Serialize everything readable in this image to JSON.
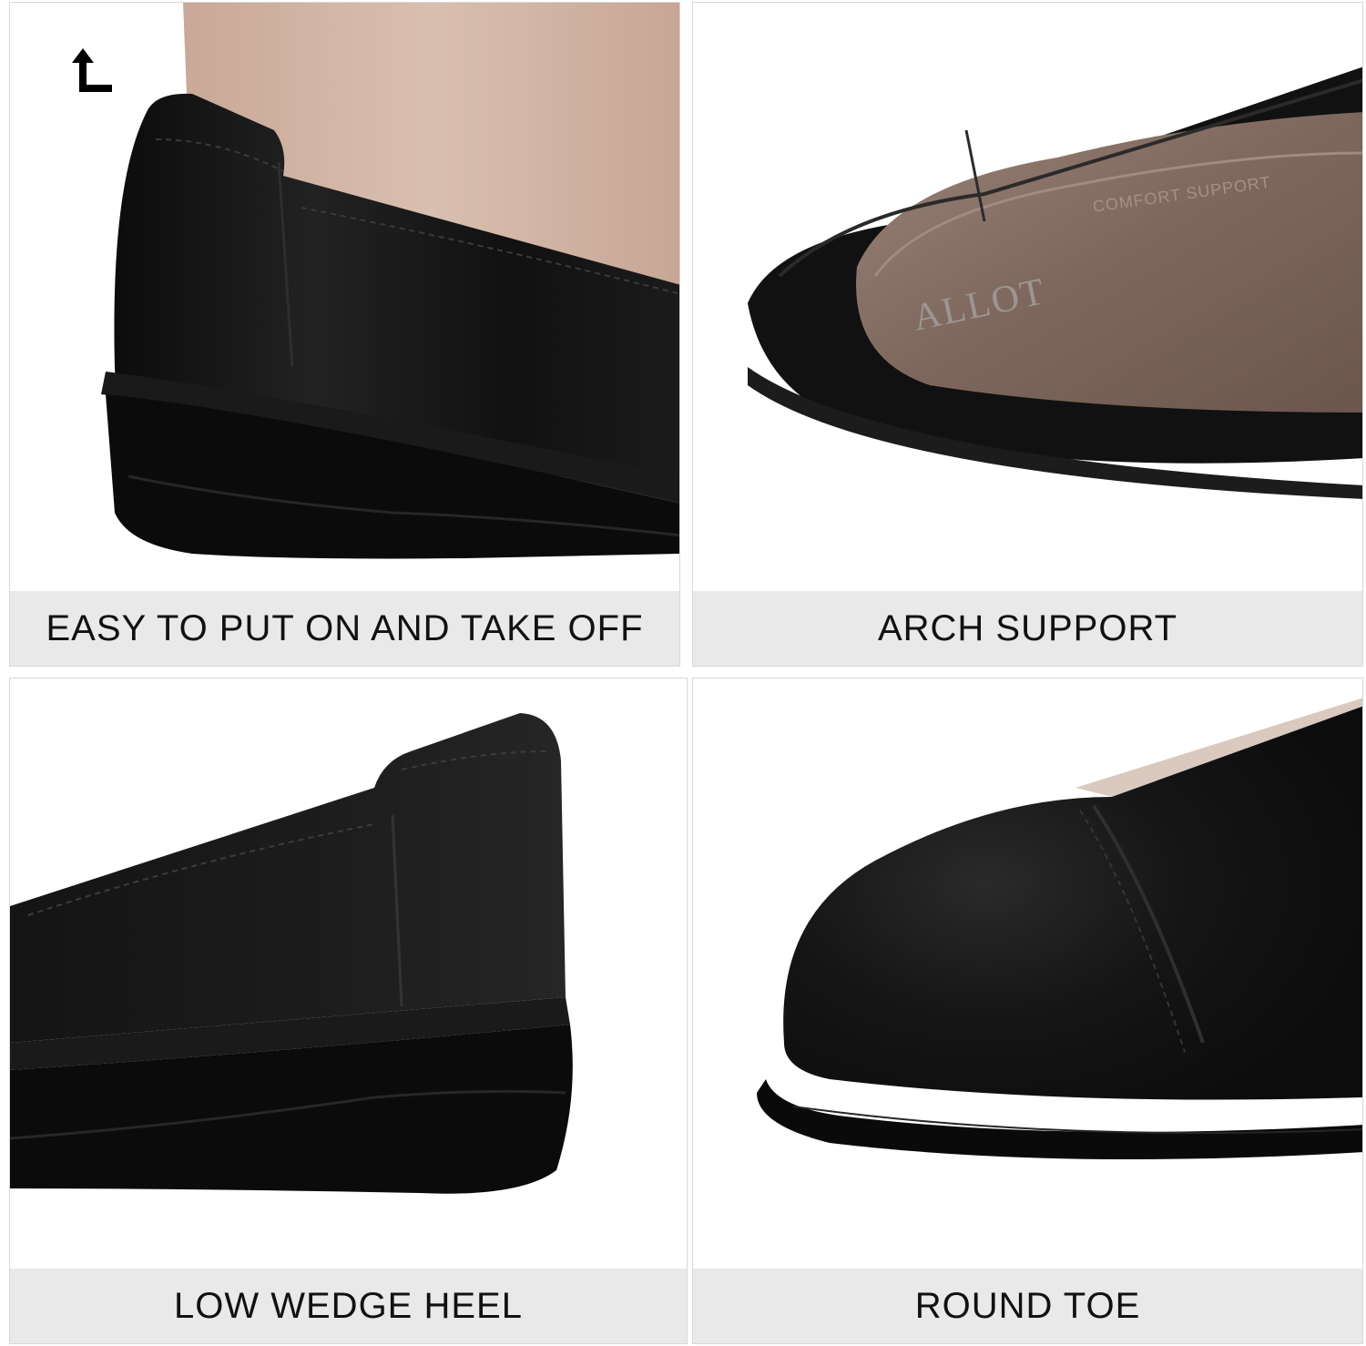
{
  "panels": [
    {
      "caption": "EASY TO PUT ON AND TAKE OFF",
      "icon": "arrow-up-turn-icon"
    },
    {
      "caption": "ARCH SUPPORT",
      "brand": "ALLOT",
      "insole_print": "COMFORT SUPPORT"
    },
    {
      "caption": "LOW WEDGE HEEL"
    },
    {
      "caption": "ROUND TOE"
    }
  ],
  "colors": {
    "shoe_black": "#141414",
    "sole_black": "#0b0b0b",
    "skin": "#d4b8a8",
    "insole": "#8a7468",
    "caption_bg": "#e9e9e9"
  }
}
